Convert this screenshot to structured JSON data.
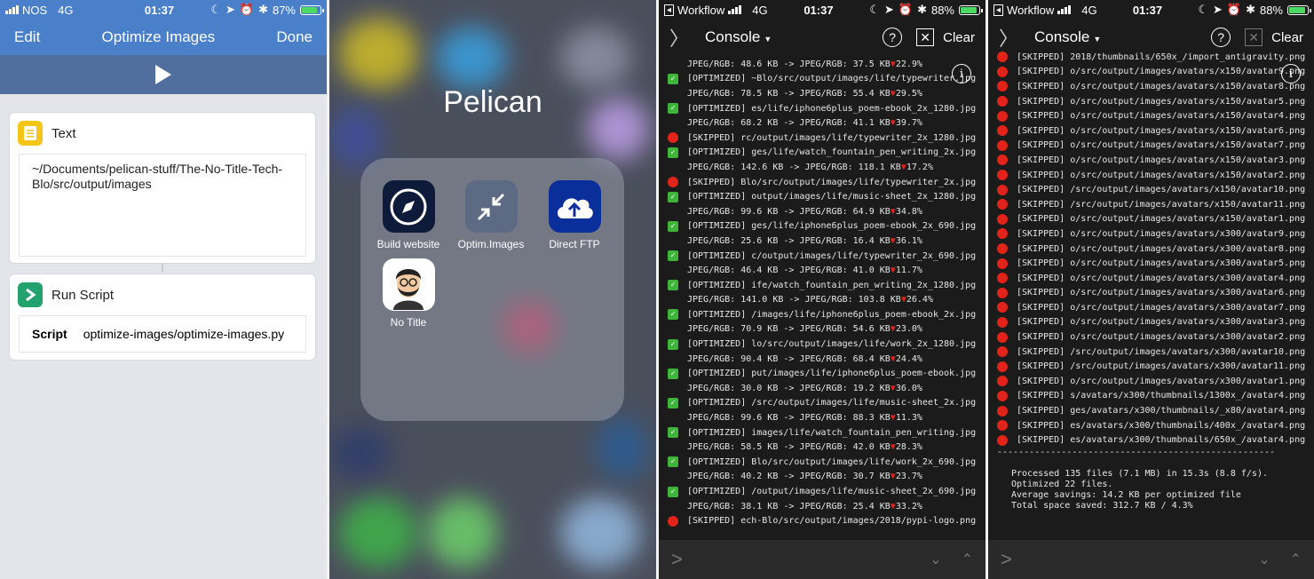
{
  "panel1": {
    "status": {
      "carrier": "NOS",
      "network": "4G",
      "time": "01:37",
      "battery": "87%",
      "battery_level": 0.87
    },
    "nav": {
      "left": "Edit",
      "title": "Optimize Images",
      "right": "Done"
    },
    "text_card": {
      "title": "Text",
      "content": "~/Documents/pelican-stuff/The-No-Title-Tech-Blo/src/output/images"
    },
    "script_card": {
      "title": "Run Script",
      "label": "Script",
      "value": "optimize-images/optimize-images.py"
    }
  },
  "panel2": {
    "folder_title": "Pelican",
    "apps": [
      {
        "label": "Build website",
        "icon": "compass-icon"
      },
      {
        "label": "Optim.Images",
        "icon": "compress-arrows-icon"
      },
      {
        "label": "Direct FTP",
        "icon": "cloud-upload-icon"
      },
      {
        "label": "No Title",
        "icon": "avatar-icon"
      }
    ]
  },
  "panel3": {
    "status": {
      "app": "Workflow",
      "network": "4G",
      "time": "01:37",
      "battery": "88%",
      "battery_level": 0.88
    },
    "header": {
      "title": "Console",
      "clear": "Clear"
    },
    "lines": [
      {
        "m": "none",
        "t": "JPEG/RGB: 48.6 KB -> JPEG/RGB: 37.5 KB ",
        "p": "22.9%"
      },
      {
        "m": "ok",
        "t": "[OPTIMIZED] ~Blo/src/output/images/life/typewriter.jpg"
      },
      {
        "m": "none",
        "t": "JPEG/RGB: 78.5 KB -> JPEG/RGB: 55.4 KB ",
        "p": "29.5%"
      },
      {
        "m": "ok",
        "t": "[OPTIMIZED] es/life/iphone6plus_poem-ebook_2x_1280.jpg"
      },
      {
        "m": "none",
        "t": "JPEG/RGB: 68.2 KB -> JPEG/RGB: 41.1 KB ",
        "p": "39.7%"
      },
      {
        "m": "sk",
        "t": "[SKIPPED] rc/output/images/life/typewriter_2x_1280.jpg"
      },
      {
        "m": "ok",
        "t": "[OPTIMIZED] ges/life/watch_fountain_pen_writing_2x.jpg"
      },
      {
        "m": "none",
        "t": "JPEG/RGB: 142.6 KB -> JPEG/RGB: 118.1 KB ",
        "p": "17.2%"
      },
      {
        "m": "sk",
        "t": "[SKIPPED] Blo/src/output/images/life/typewriter_2x.jpg"
      },
      {
        "m": "ok",
        "t": "[OPTIMIZED] output/images/life/music-sheet_2x_1280.jpg"
      },
      {
        "m": "none",
        "t": "JPEG/RGB: 99.6 KB -> JPEG/RGB: 64.9 KB ",
        "p": "34.8%"
      },
      {
        "m": "ok",
        "t": "[OPTIMIZED] ges/life/iphone6plus_poem-ebook_2x_690.jpg"
      },
      {
        "m": "none",
        "t": "JPEG/RGB: 25.6 KB -> JPEG/RGB: 16.4 KB ",
        "p": "36.1%"
      },
      {
        "m": "ok",
        "t": "[OPTIMIZED] c/output/images/life/typewriter_2x_690.jpg"
      },
      {
        "m": "none",
        "t": "JPEG/RGB: 46.4 KB -> JPEG/RGB: 41.0 KB ",
        "p": "11.7%"
      },
      {
        "m": "ok",
        "t": "[OPTIMIZED] ife/watch_fountain_pen_writing_2x_1280.jpg"
      },
      {
        "m": "none",
        "t": "JPEG/RGB: 141.0 KB -> JPEG/RGB: 103.8 KB ",
        "p": "26.4%"
      },
      {
        "m": "ok",
        "t": "[OPTIMIZED] /images/life/iphone6plus_poem-ebook_2x.jpg"
      },
      {
        "m": "none",
        "t": "JPEG/RGB: 70.9 KB -> JPEG/RGB: 54.6 KB ",
        "p": "23.0%"
      },
      {
        "m": "ok",
        "t": "[OPTIMIZED] lo/src/output/images/life/work_2x_1280.jpg"
      },
      {
        "m": "none",
        "t": "JPEG/RGB: 90.4 KB -> JPEG/RGB: 68.4 KB ",
        "p": "24.4%"
      },
      {
        "m": "ok",
        "t": "[OPTIMIZED] put/images/life/iphone6plus_poem-ebook.jpg"
      },
      {
        "m": "none",
        "t": "JPEG/RGB: 30.0 KB -> JPEG/RGB: 19.2 KB ",
        "p": "36.0%"
      },
      {
        "m": "ok",
        "t": "[OPTIMIZED] /src/output/images/life/music-sheet_2x.jpg"
      },
      {
        "m": "none",
        "t": "JPEG/RGB: 99.6 KB -> JPEG/RGB: 88.3 KB ",
        "p": "11.3%"
      },
      {
        "m": "ok",
        "t": "[OPTIMIZED] images/life/watch_fountain_pen_writing.jpg"
      },
      {
        "m": "none",
        "t": "JPEG/RGB: 58.5 KB -> JPEG/RGB: 42.0 KB ",
        "p": "28.3%"
      },
      {
        "m": "ok",
        "t": "[OPTIMIZED] Blo/src/output/images/life/work_2x_690.jpg"
      },
      {
        "m": "none",
        "t": "JPEG/RGB: 40.2 KB -> JPEG/RGB: 30.7 KB ",
        "p": "23.7%"
      },
      {
        "m": "ok",
        "t": "[OPTIMIZED] /output/images/life/music-sheet_2x_690.jpg"
      },
      {
        "m": "none",
        "t": "JPEG/RGB: 38.1 KB -> JPEG/RGB: 25.4 KB ",
        "p": "33.2%"
      },
      {
        "m": "sk",
        "t": "[SKIPPED] ech-Blo/src/output/images/2018/pypi-logo.png"
      }
    ]
  },
  "panel4": {
    "status": {
      "app": "Workflow",
      "network": "4G",
      "time": "01:37",
      "battery": "88%",
      "battery_level": 0.88
    },
    "header": {
      "title": "Console",
      "clear": "Clear"
    },
    "lines": [
      {
        "m": "sk",
        "t": "[SKIPPED] 2018/thumbnails/650x_/import_antigravity.png"
      },
      {
        "m": "sk",
        "t": "[SKIPPED] o/src/output/images/avatars/x150/avatar9.png"
      },
      {
        "m": "sk",
        "t": "[SKIPPED] o/src/output/images/avatars/x150/avatar8.png"
      },
      {
        "m": "sk",
        "t": "[SKIPPED] o/src/output/images/avatars/x150/avatar5.png"
      },
      {
        "m": "sk",
        "t": "[SKIPPED] o/src/output/images/avatars/x150/avatar4.png"
      },
      {
        "m": "sk",
        "t": "[SKIPPED] o/src/output/images/avatars/x150/avatar6.png"
      },
      {
        "m": "sk",
        "t": "[SKIPPED] o/src/output/images/avatars/x150/avatar7.png"
      },
      {
        "m": "sk",
        "t": "[SKIPPED] o/src/output/images/avatars/x150/avatar3.png"
      },
      {
        "m": "sk",
        "t": "[SKIPPED] o/src/output/images/avatars/x150/avatar2.png"
      },
      {
        "m": "sk",
        "t": "[SKIPPED] /src/output/images/avatars/x150/avatar10.png"
      },
      {
        "m": "sk",
        "t": "[SKIPPED] /src/output/images/avatars/x150/avatar11.png"
      },
      {
        "m": "sk",
        "t": "[SKIPPED] o/src/output/images/avatars/x150/avatar1.png"
      },
      {
        "m": "sk",
        "t": "[SKIPPED] o/src/output/images/avatars/x300/avatar9.png"
      },
      {
        "m": "sk",
        "t": "[SKIPPED] o/src/output/images/avatars/x300/avatar8.png"
      },
      {
        "m": "sk",
        "t": "[SKIPPED] o/src/output/images/avatars/x300/avatar5.png"
      },
      {
        "m": "sk",
        "t": "[SKIPPED] o/src/output/images/avatars/x300/avatar4.png"
      },
      {
        "m": "sk",
        "t": "[SKIPPED] o/src/output/images/avatars/x300/avatar6.png"
      },
      {
        "m": "sk",
        "t": "[SKIPPED] o/src/output/images/avatars/x300/avatar7.png"
      },
      {
        "m": "sk",
        "t": "[SKIPPED] o/src/output/images/avatars/x300/avatar3.png"
      },
      {
        "m": "sk",
        "t": "[SKIPPED] o/src/output/images/avatars/x300/avatar2.png"
      },
      {
        "m": "sk",
        "t": "[SKIPPED] /src/output/images/avatars/x300/avatar10.png"
      },
      {
        "m": "sk",
        "t": "[SKIPPED] /src/output/images/avatars/x300/avatar11.png"
      },
      {
        "m": "sk",
        "t": "[SKIPPED] o/src/output/images/avatars/x300/avatar1.png"
      },
      {
        "m": "sk",
        "t": "[SKIPPED] s/avatars/x300/thumbnails/1300x_/avatar4.png"
      },
      {
        "m": "sk",
        "t": "[SKIPPED] ges/avatars/x300/thumbnails/_x80/avatar4.png"
      },
      {
        "m": "sk",
        "t": "[SKIPPED] es/avatars/x300/thumbnails/400x_/avatar4.png"
      },
      {
        "m": "sk",
        "t": "[SKIPPED] es/avatars/x300/thumbnails/650x_/avatar4.png"
      }
    ],
    "separator": "----------------------------------------------------",
    "summary": [
      "Processed 135 files (7.1 MB) in 15.3s (8.8 f/s).",
      "Optimized 22 files.",
      "Average savings: 14.2 KB per optimized file",
      "Total space saved: 312.7 KB / 4.3%"
    ]
  }
}
